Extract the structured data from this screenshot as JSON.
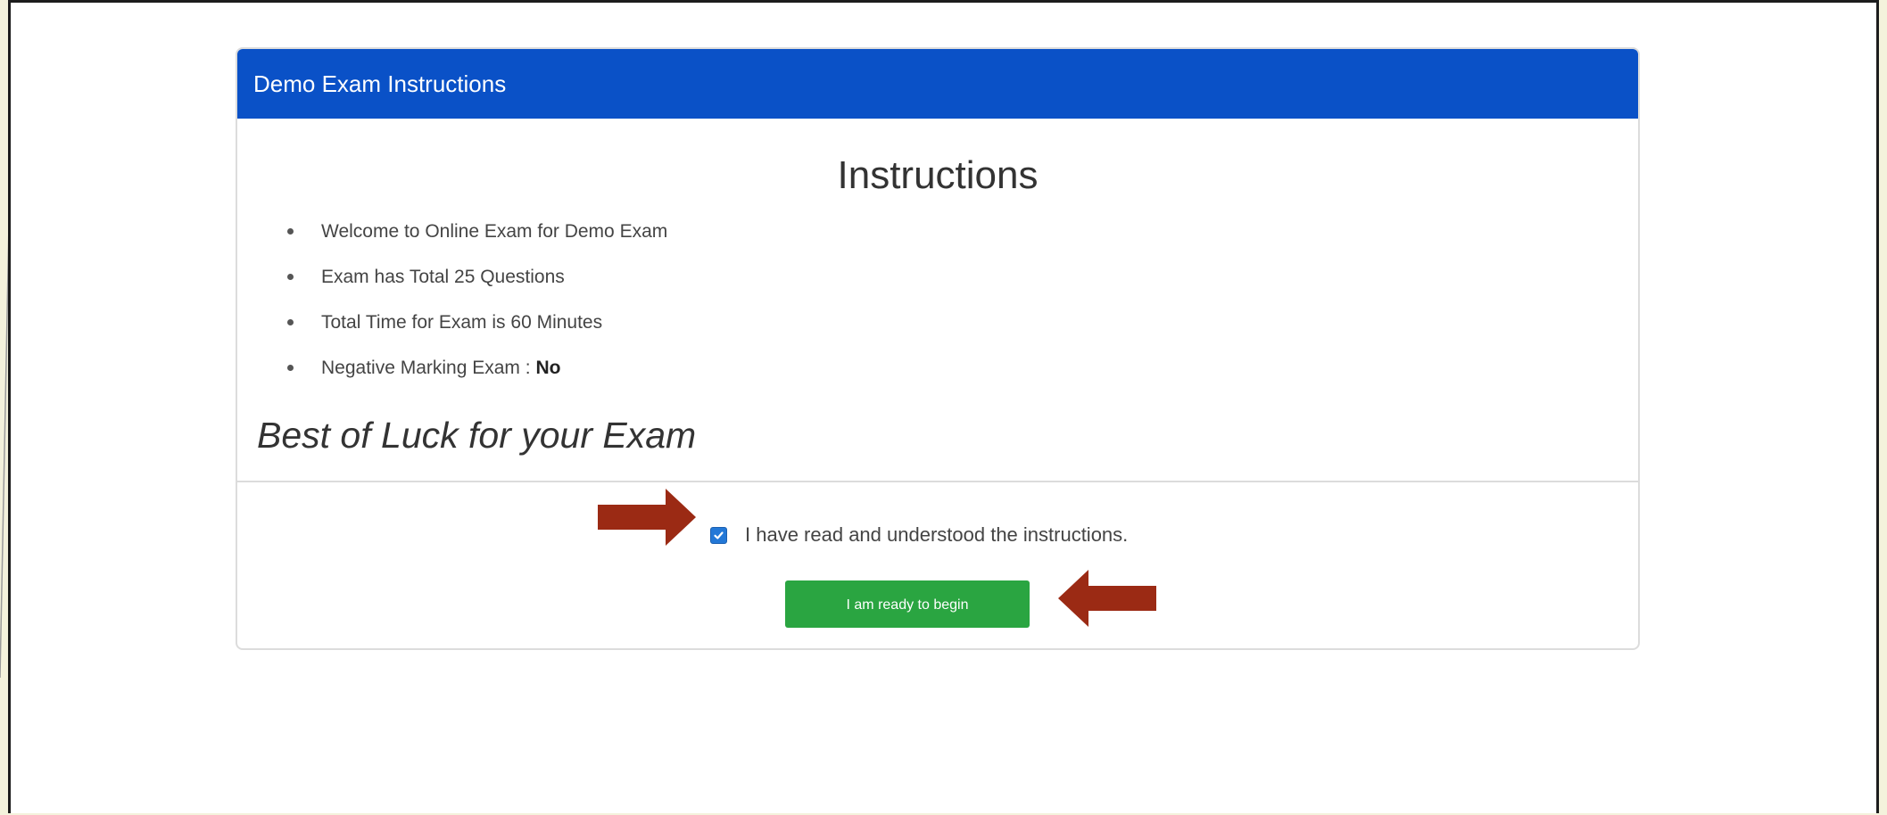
{
  "panel": {
    "header_title": "Demo Exam Instructions",
    "body_title": "Instructions",
    "instructions": [
      {
        "text": "Welcome to Online Exam for Demo Exam",
        "bold": ""
      },
      {
        "text": "Exam has Total 25 Questions",
        "bold": ""
      },
      {
        "text": "Total Time for Exam is 60 Minutes",
        "bold": ""
      },
      {
        "text": "Negative Marking Exam : ",
        "bold": "No"
      }
    ],
    "closing_message": "Best of Luck for your Exam"
  },
  "footer": {
    "checkbox_label": "I have read and understood the instructions.",
    "checkbox_checked": true,
    "begin_button_label": "I am ready to begin"
  },
  "colors": {
    "header_blue": "#0a51c7",
    "button_green": "#2aa541",
    "arrow_red": "#9b2a14"
  }
}
